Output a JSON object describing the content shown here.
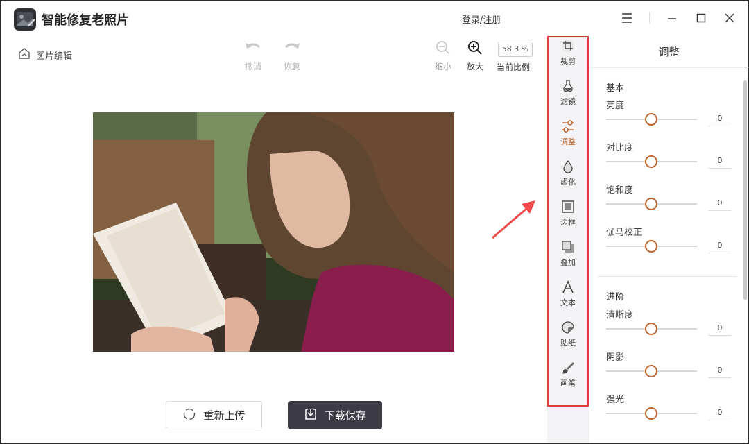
{
  "app": {
    "title": "智能修复老照片",
    "login": "登录/注册"
  },
  "toolbar": {
    "home_label": "图片编辑",
    "undo": "撤消",
    "redo": "恢复",
    "zoom_out": "缩小",
    "zoom_in": "放大",
    "zoom_value": "58.3 %",
    "ratio_label": "当前比例"
  },
  "actions": {
    "reupload": "重新上传",
    "download": "下载保存"
  },
  "tools": [
    {
      "label": "裁剪",
      "icon": "crop-icon"
    },
    {
      "label": "滤镜",
      "icon": "filter-icon"
    },
    {
      "label": "调整",
      "icon": "adjust-icon",
      "active": true
    },
    {
      "label": "虚化",
      "icon": "blur-icon"
    },
    {
      "label": "边框",
      "icon": "border-icon"
    },
    {
      "label": "叠加",
      "icon": "overlay-icon"
    },
    {
      "label": "文本",
      "icon": "text-icon"
    },
    {
      "label": "贴纸",
      "icon": "sticker-icon"
    },
    {
      "label": "画笔",
      "icon": "brush-icon"
    }
  ],
  "panel": {
    "title": "调整",
    "basic_title": "基本",
    "advanced_title": "进阶",
    "basic": [
      {
        "label": "亮度",
        "value": "0"
      },
      {
        "label": "对比度",
        "value": "0"
      },
      {
        "label": "饱和度",
        "value": "0"
      },
      {
        "label": "伽马校正",
        "value": "0"
      }
    ],
    "advanced": [
      {
        "label": "清晰度",
        "value": "0"
      },
      {
        "label": "阴影",
        "value": "0"
      },
      {
        "label": "强光",
        "value": "0"
      }
    ]
  },
  "colors": {
    "accent": "#c0642e",
    "highlight": "#e03a3a",
    "dark_button": "#3b3a45"
  }
}
